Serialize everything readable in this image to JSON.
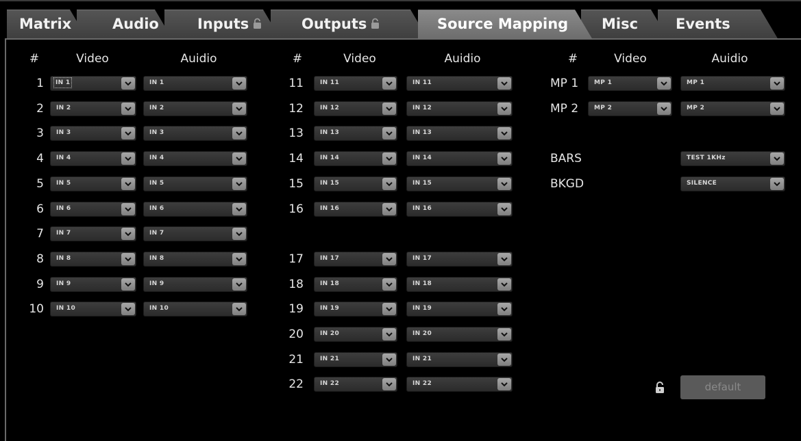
{
  "tabs": [
    {
      "label": "Matrix",
      "locked": false,
      "active": false
    },
    {
      "label": "Audio",
      "locked": false,
      "active": false
    },
    {
      "label": "Inputs",
      "locked": true,
      "active": false
    },
    {
      "label": "Outputs",
      "locked": true,
      "active": false
    },
    {
      "label": "Source Mapping",
      "locked": false,
      "active": true
    },
    {
      "label": "Misc",
      "locked": false,
      "active": false
    },
    {
      "label": "Events",
      "locked": false,
      "active": false
    }
  ],
  "headers": {
    "num": "#",
    "video": "Video",
    "audio": "Auidio"
  },
  "left_rows": [
    {
      "num": "1",
      "video": "IN 1",
      "audio": "IN 1"
    },
    {
      "num": "2",
      "video": "IN 2",
      "audio": "IN 2"
    },
    {
      "num": "3",
      "video": "IN 3",
      "audio": "IN 3"
    },
    {
      "num": "4",
      "video": "IN 4",
      "audio": "IN 4"
    },
    {
      "num": "5",
      "video": "IN 5",
      "audio": "IN 5"
    },
    {
      "num": "6",
      "video": "IN 6",
      "audio": "IN 6"
    },
    {
      "num": "7",
      "video": "IN 7",
      "audio": "IN 7"
    },
    {
      "num": "8",
      "video": "IN 8",
      "audio": "IN 8"
    },
    {
      "num": "9",
      "video": "IN 9",
      "audio": "IN 9"
    },
    {
      "num": "10",
      "video": "IN 10",
      "audio": "IN 10"
    }
  ],
  "middle_rows_a": [
    {
      "num": "11",
      "video": "IN 11",
      "audio": "IN 11"
    },
    {
      "num": "12",
      "video": "IN 12",
      "audio": "IN 12"
    },
    {
      "num": "13",
      "video": "IN 13",
      "audio": "IN 13"
    },
    {
      "num": "14",
      "video": "IN 14",
      "audio": "IN 14"
    },
    {
      "num": "15",
      "video": "IN 15",
      "audio": "IN 15"
    },
    {
      "num": "16",
      "video": "IN 16",
      "audio": "IN 16"
    }
  ],
  "middle_rows_b": [
    {
      "num": "17",
      "video": "IN 17",
      "audio": "IN 17"
    },
    {
      "num": "18",
      "video": "IN 18",
      "audio": "IN 18"
    },
    {
      "num": "19",
      "video": "IN 19",
      "audio": "IN 19"
    },
    {
      "num": "20",
      "video": "IN 20",
      "audio": "IN 20"
    },
    {
      "num": "21",
      "video": "IN 21",
      "audio": "IN 21"
    },
    {
      "num": "22",
      "video": "IN 22",
      "audio": "IN 22"
    }
  ],
  "mp_rows": [
    {
      "num": "MP 1",
      "video": "MP 1",
      "audio": "MP 1"
    },
    {
      "num": "MP 2",
      "video": "MP 2",
      "audio": "MP 2"
    }
  ],
  "special_rows": [
    {
      "label": "BARS",
      "audio": "TEST 1KHz"
    },
    {
      "label": "BKGD",
      "audio": "SILENCE"
    }
  ],
  "default_button": "default",
  "icons": {
    "dropdown_arrow": "chevron-down-icon",
    "lock": "padlock-icon"
  },
  "colors": {
    "background": "#000000",
    "tab": "#4a4a4a",
    "tab_active": "#7a7a7a",
    "dropdown": "#333333",
    "arrow": "#999999"
  }
}
